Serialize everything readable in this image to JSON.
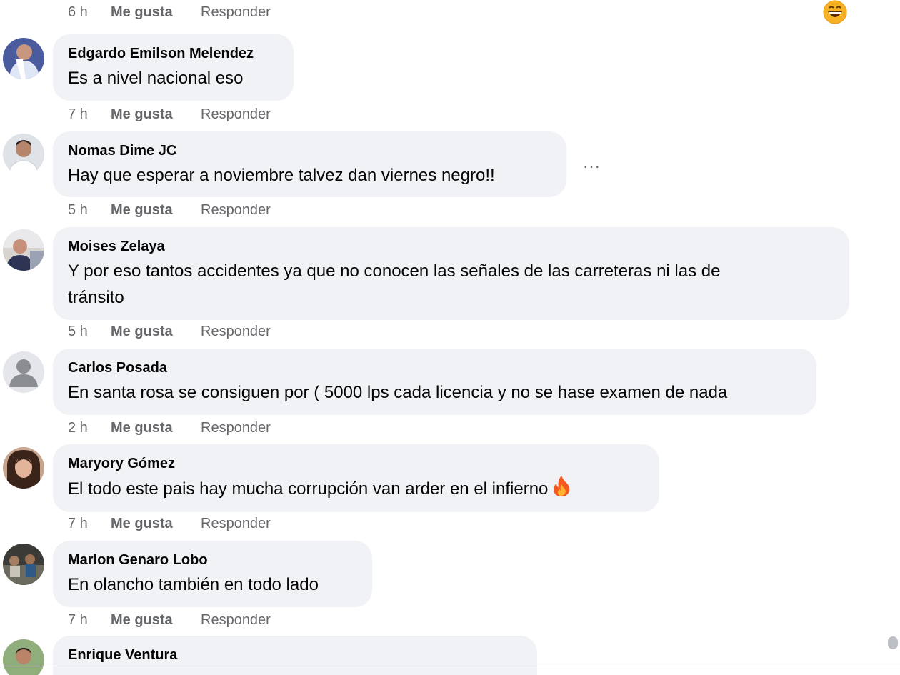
{
  "top_meta": {
    "time": "6 h",
    "like": "Me gusta",
    "reply": "Responder"
  },
  "comments": [
    {
      "author": "Edgardo Emilson Melendez",
      "text": "Es a nivel nacional eso",
      "time": "7 h",
      "like": "Me gusta",
      "reply": "Responder"
    },
    {
      "author": "Nomas Dime JC",
      "text": "Hay que esperar a noviembre talvez dan viernes negro!!",
      "time": "5 h",
      "like": "Me gusta",
      "reply": "Responder"
    },
    {
      "author": "Moises Zelaya",
      "text_line1": "Y por eso tantos accidentes ya que no conocen las señales de las carreteras ni las de",
      "text_line2": "tránsito",
      "time": "5 h",
      "like": "Me gusta",
      "reply": "Responder"
    },
    {
      "author": "Carlos Posada",
      "text": "En santa rosa se consiguen por ( 5000 lps cada licencia y no se hase examen de nada",
      "time": "2 h",
      "like": "Me gusta",
      "reply": "Responder"
    },
    {
      "author": "Maryory Gómez",
      "text": "El todo este pais hay mucha corrupción van arder en el infierno",
      "emoji": "fire-icon",
      "time": "7 h",
      "like": "Me gusta",
      "reply": "Responder"
    },
    {
      "author": "Marlon Genaro Lobo",
      "text": "En olancho también en todo lado",
      "time": "7 h",
      "like": "Me gusta",
      "reply": "Responder"
    },
    {
      "author": "Enrique Ventura"
    }
  ],
  "more_options": "···",
  "colors": {
    "bubble": "#f0f2f5",
    "meta": "#65676b",
    "text": "#050505"
  }
}
